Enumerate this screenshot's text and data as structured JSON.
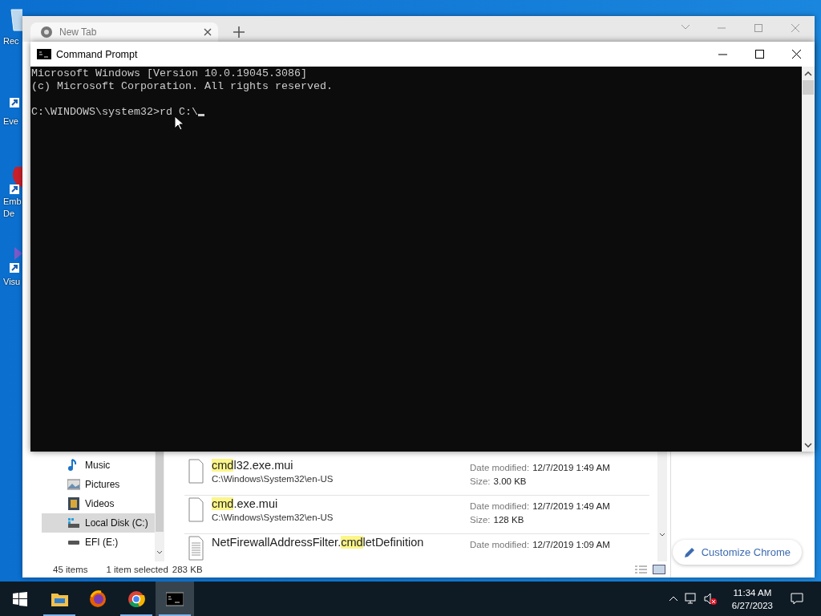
{
  "desktop": {
    "icons": [
      {
        "kind": "recycle",
        "lines": [
          "Rec"
        ]
      },
      {
        "kind": "app",
        "lines": [
          "Eve"
        ]
      },
      {
        "kind": "red",
        "lines": [
          "Emb",
          "De"
        ]
      },
      {
        "kind": "purple",
        "lines": [
          "Visu"
        ]
      }
    ]
  },
  "browser": {
    "tab": {
      "title": "New Tab",
      "selected": true
    },
    "customize_button": "Customize Chrome"
  },
  "explorer": {
    "nav_items": [
      {
        "kind": "music",
        "label": "Music",
        "selected": false
      },
      {
        "kind": "pictures",
        "label": "Pictures",
        "selected": false
      },
      {
        "kind": "videos",
        "label": "Videos",
        "selected": false
      },
      {
        "kind": "disk",
        "label": "Local Disk (C:)",
        "selected": true
      },
      {
        "kind": "drive",
        "label": "EFI (E:)",
        "selected": false
      }
    ],
    "results": [
      {
        "kind": "blank",
        "name_parts": [
          {
            "text": "cmd",
            "highlighted": true
          },
          {
            "text": "l32.exe.mui",
            "highlighted": false
          }
        ],
        "path": "C:\\Windows\\System32\\en-US",
        "date_label": "Date modified:",
        "date": "12/7/2019 1:49 AM",
        "size_label": "Size:",
        "size": "3.00 KB"
      },
      {
        "kind": "blank",
        "name_parts": [
          {
            "text": "cmd",
            "highlighted": true
          },
          {
            "text": ".exe.mui",
            "highlighted": false
          }
        ],
        "path": "C:\\Windows\\System32\\en-US",
        "date_label": "Date modified:",
        "date": "12/7/2019 1:49 AM",
        "size_label": "Size:",
        "size": "128 KB"
      },
      {
        "kind": "text",
        "name_parts": [
          {
            "text": "NetFirewallAddressFilter.",
            "highlighted": false
          },
          {
            "text": "cmd",
            "highlighted": true
          },
          {
            "text": "letDefinition",
            "highlighted": false
          }
        ],
        "date_label": "Date modified:",
        "date": "12/7/2019 1:09 AM"
      }
    ],
    "status_bar": {
      "item_count": "45 items",
      "selection": "1 item selected",
      "selection_size": "283 KB"
    }
  },
  "console": {
    "title": "Command Prompt",
    "lines": [
      "Microsoft Windows [Version 10.0.19045.3086]",
      "(c) Microsoft Corporation. All rights reserved."
    ],
    "prompt": "C:\\WINDOWS\\system32>",
    "input": "rd C:\\"
  },
  "taskbar": {
    "apps": [
      {
        "kind": "explorer",
        "running": true,
        "selected": false
      },
      {
        "kind": "firefox",
        "running": false,
        "selected": false
      },
      {
        "kind": "chrome",
        "running": true,
        "selected": false
      },
      {
        "kind": "console",
        "running": true,
        "selected": true
      }
    ],
    "time": "11:34 AM",
    "date": "6/27/2023"
  }
}
